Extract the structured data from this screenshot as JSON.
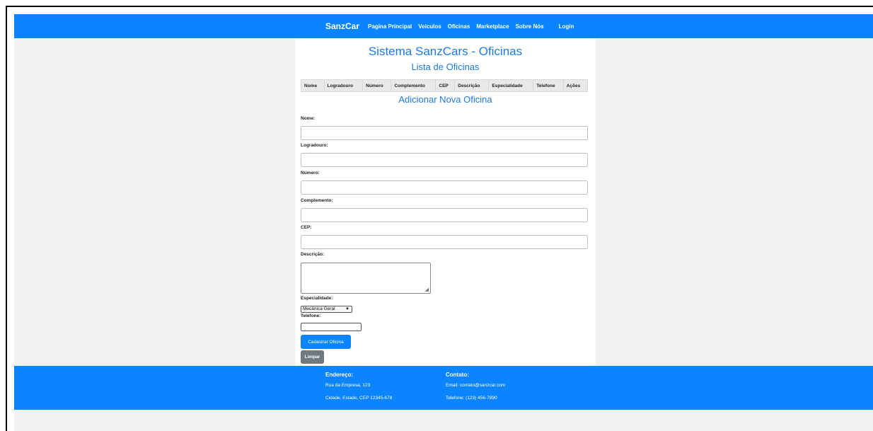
{
  "nav": {
    "brand": "SanzCar",
    "links": [
      "Pagina Principal",
      "Veiculos",
      "Oficinas",
      "Marketplace",
      "Sobre Nós"
    ],
    "login": "Login"
  },
  "page": {
    "title": "Sistema SanzCars - Oficinas",
    "subtitle": "Lista de Oficinas"
  },
  "table": {
    "columns": [
      "Nome",
      "Logradouro",
      "Número",
      "Complemento",
      "CEP",
      "Descrição",
      "Especialidade",
      "Telefone",
      "Ações"
    ]
  },
  "form": {
    "title": "Adicionar Nova Oficina",
    "labels": {
      "nome": "Nome:",
      "logradouro": "Logradouro:",
      "numero": "Número:",
      "complemento": "Complemento:",
      "cep": "CEP:",
      "descricao": "Descrição:",
      "especialidade": "Especialidade:",
      "telefone": "Telefone:"
    },
    "values": {
      "nome": "",
      "logradouro": "",
      "numero": "",
      "complemento": "",
      "cep": "",
      "descricao": "",
      "telefone": ""
    },
    "especialidade_selected": "Mecânica Geral",
    "submit_label": "Cadastrar Oficina",
    "clear_label": "Limpar"
  },
  "footer": {
    "address": {
      "heading": "Endereço:",
      "line1": "Rua da Empresa, 123",
      "line2": "Cidade, Estado, CEP 12345-678"
    },
    "contact": {
      "heading": "Contato:",
      "email": "Email: contato@sanzcar.com",
      "phone": "Telefone: (123) 456-7890"
    }
  },
  "colors": {
    "primary": "#0a84ff",
    "title_blue": "#1e7ae0",
    "page_bg": "#f1f1f1",
    "secondary_button": "#707880"
  }
}
